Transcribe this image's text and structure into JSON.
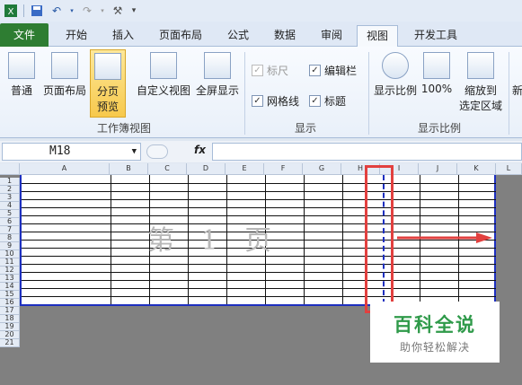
{
  "qat": {
    "icons": [
      "excel-icon",
      "save-icon",
      "undo-icon",
      "redo-icon",
      "customize-icon"
    ]
  },
  "tabs": [
    {
      "label": "文件"
    },
    {
      "label": "开始"
    },
    {
      "label": "插入"
    },
    {
      "label": "页面布局"
    },
    {
      "label": "公式"
    },
    {
      "label": "数据"
    },
    {
      "label": "审阅"
    },
    {
      "label": "视图"
    },
    {
      "label": "开发工具"
    }
  ],
  "ribbon": {
    "workbook_views": {
      "group_label": "工作簿视图",
      "normal": "普通",
      "page_layout": "页面布局",
      "page_break_line1": "分页",
      "page_break_line2": "预览",
      "custom_view": "自定义视图",
      "full_screen": "全屏显示"
    },
    "show": {
      "group_label": "显示",
      "ruler": "标尺",
      "formula_bar": "编辑栏",
      "gridlines": "网格线",
      "headings": "标题",
      "check_mark": "✓"
    },
    "zoom": {
      "group_label": "显示比例",
      "zoom": "显示比例",
      "percent": "100%",
      "to_sel_line1": "缩放到",
      "to_sel_line2": "选定区域",
      "new_window_partial": "新"
    }
  },
  "formula_bar": {
    "name_box": "M18",
    "fx": "fx",
    "formula": ""
  },
  "sheet": {
    "columns": [
      "A",
      "B",
      "C",
      "D",
      "E",
      "F",
      "G",
      "H",
      "I",
      "J",
      "K",
      "L"
    ],
    "rows": [
      "1",
      "2",
      "3",
      "4",
      "5",
      "6",
      "7",
      "8",
      "9",
      "10",
      "11",
      "12",
      "13",
      "14",
      "15",
      "16",
      "17",
      "18",
      "19",
      "20",
      "21"
    ],
    "watermark": "第 1 页"
  },
  "brand": {
    "title": "百科全说",
    "subtitle": "助你轻松解决"
  },
  "colors": {
    "file_tab": "#2e7d32",
    "page_border": "#1d2fbf",
    "annotation_red": "#e2403f",
    "brand_green": "#2f9a4a"
  }
}
